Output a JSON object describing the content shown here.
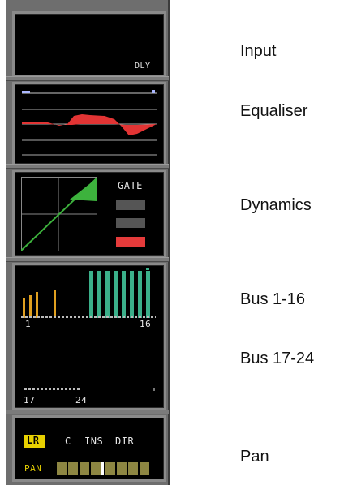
{
  "strip": {
    "input": {
      "tag": "DLY"
    },
    "dynamics": {
      "tag": "GATE",
      "leds": [
        "off",
        "off",
        "on"
      ]
    },
    "bus_lo": {
      "start": "1",
      "end": "16"
    },
    "bus_hi": {
      "start": "17",
      "end": "24"
    },
    "pan": {
      "lr": "LR",
      "c": "C",
      "ins": "INS",
      "dir": "DIR",
      "pan": "PAN"
    }
  },
  "labels": {
    "input": "Input",
    "eq": "Equaliser",
    "dynamics": "Dynamics",
    "bus_lo": "Bus 1-16",
    "bus_hi": "Bus 17-24",
    "pan": "Pan"
  },
  "colors": {
    "eq_curve": "#e23434",
    "dyn_fill": "#3db23d",
    "bus_yellow": "#e0a020",
    "bus_green": "#3bb08a",
    "led_on": "#e53b3b",
    "led_off": "#555555",
    "pan_seg": "#8d8642",
    "lr_bg": "#e7d000"
  }
}
